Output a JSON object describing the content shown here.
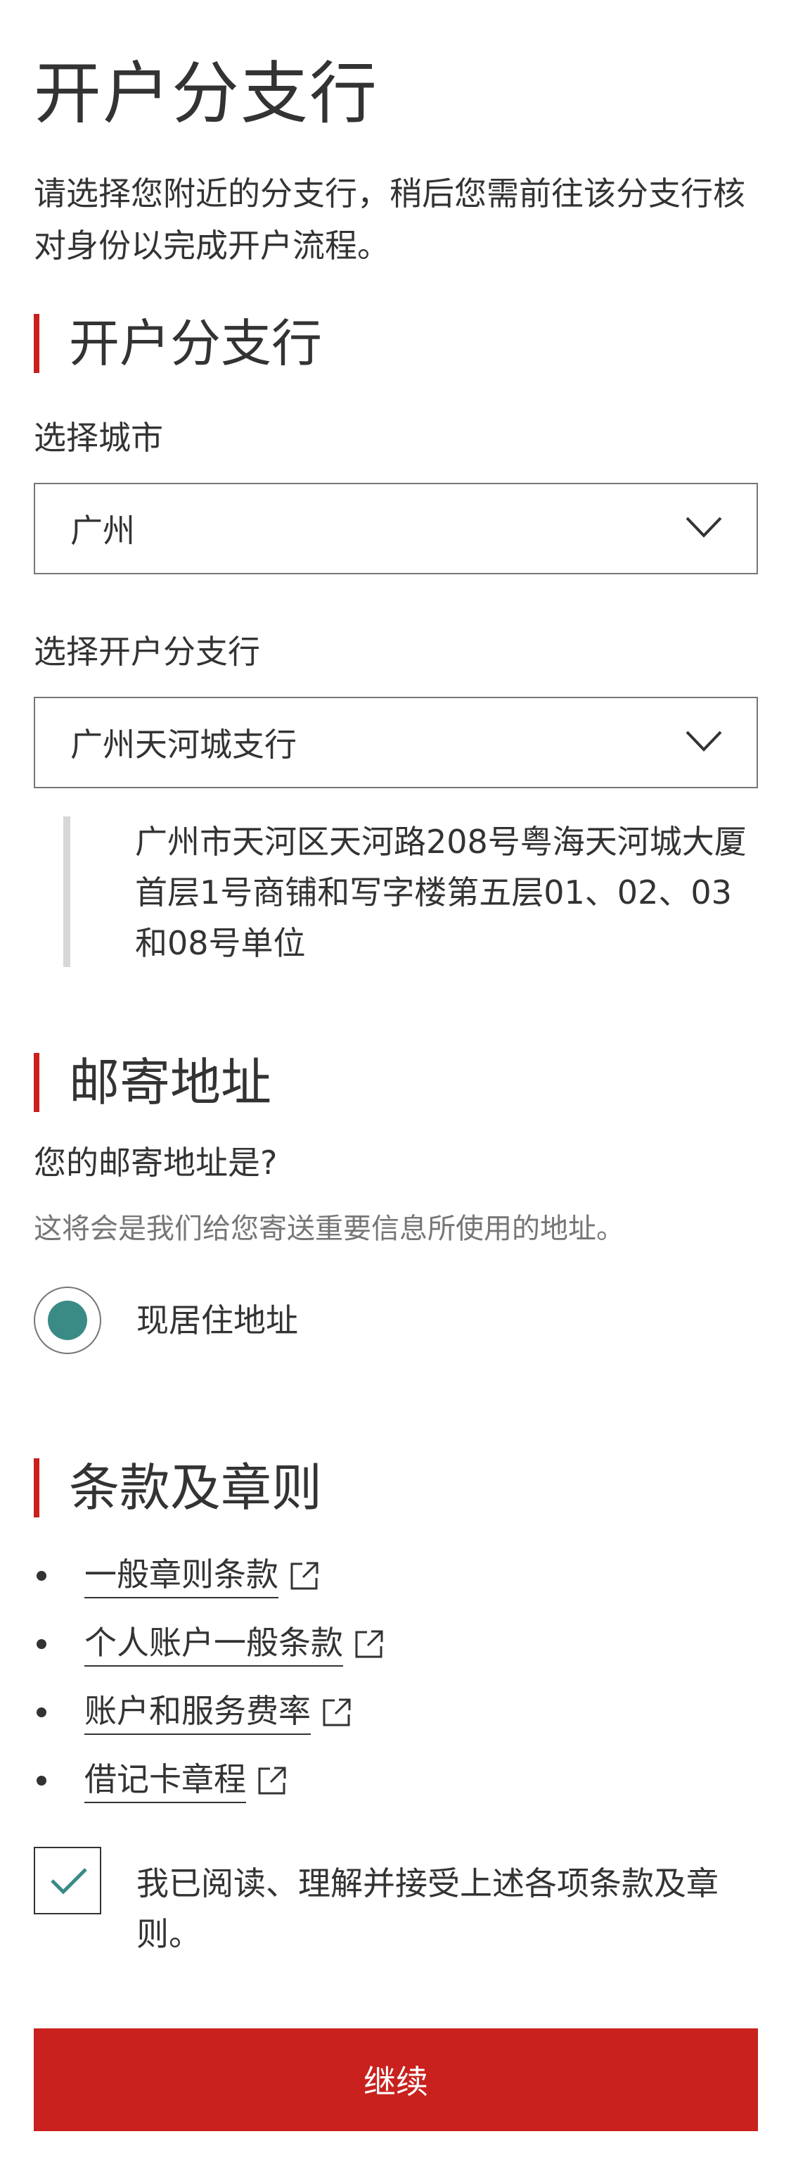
{
  "page": {
    "title": "开户分支行",
    "intro": "请选择您附近的分支行，稍后您需前往该分支行核对身份以完成开户流程。"
  },
  "branch_section": {
    "heading": "开户分支行",
    "city_label": "选择城市",
    "city_value": "广州",
    "branch_label": "选择开户分支行",
    "branch_value": "广州天河城支行",
    "branch_address": "广州市天河区天河路208号粤海天河城大厦首层1号商铺和写字楼第五层01、02、03和08号单位"
  },
  "mailing_section": {
    "heading": "邮寄地址",
    "question": "您的邮寄地址是?",
    "hint": "这将会是我们给您寄送重要信息所使用的地址。",
    "option_label": "现居住地址",
    "option_selected": true
  },
  "terms_section": {
    "heading": "条款及章则",
    "links": [
      {
        "label": "一般章则条款",
        "icon": "external-link-icon"
      },
      {
        "label": "个人账户一般条款",
        "icon": "external-link-icon"
      },
      {
        "label": "账户和服务费率",
        "icon": "external-link-icon"
      },
      {
        "label": "借记卡章程",
        "icon": "external-link-icon"
      }
    ],
    "agree_label": "我已阅读、理解并接受上述各项条款及章则。",
    "agree_checked": true
  },
  "actions": {
    "continue_label": "继续"
  },
  "colors": {
    "accent_red": "#c8211e",
    "radio_teal": "#3a8a86",
    "check_teal": "#3a8a86",
    "text": "#333333",
    "hint_gray": "#767676"
  }
}
